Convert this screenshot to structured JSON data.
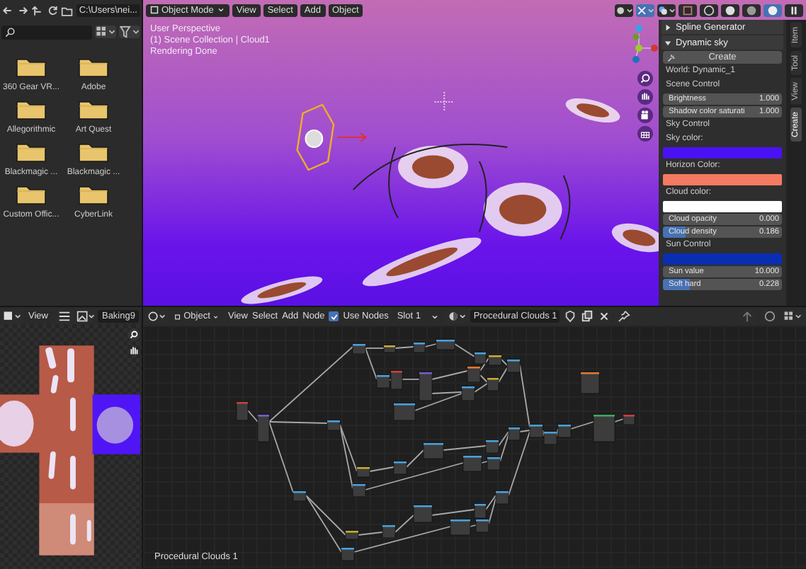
{
  "file_browser": {
    "path": "C:\\Users\\nei...",
    "folders": [
      {
        "name": "360 Gear VR..."
      },
      {
        "name": "Adobe"
      },
      {
        "name": "Allegorithmic"
      },
      {
        "name": "Art Quest"
      },
      {
        "name": "Blackmagic ..."
      },
      {
        "name": "Blackmagic ..."
      },
      {
        "name": "Custom Offic..."
      },
      {
        "name": "CyberLink"
      }
    ]
  },
  "image_editor": {
    "menu": "View",
    "image_name": "Baking9"
  },
  "viewport": {
    "mode": "Object Mode",
    "menus": [
      "View",
      "Select",
      "Add",
      "Object"
    ],
    "overlay_text": [
      "User Perspective",
      "(1) Scene Collection | Cloud1",
      "Rendering Done"
    ],
    "sidebar": {
      "panels": [
        {
          "title": "Spline Generator",
          "expanded": false
        },
        {
          "title": "Dynamic sky",
          "expanded": true,
          "create_button": "Create",
          "world": "World: Dynamic_1",
          "rows": [
            {
              "kind": "heading",
              "text": "Scene Control"
            },
            {
              "kind": "number",
              "label": "Brightness",
              "value": "1.000"
            },
            {
              "kind": "number",
              "label": "Shadow color saturati",
              "value": "1.000"
            },
            {
              "kind": "heading",
              "text": "Sky Control"
            },
            {
              "kind": "heading",
              "text": "Sky color:"
            },
            {
              "kind": "color",
              "color": "#4a12f2"
            },
            {
              "kind": "heading",
              "text": "Horizon Color:"
            },
            {
              "kind": "color",
              "color": "#f47a62"
            },
            {
              "kind": "heading",
              "text": "Cloud color:"
            },
            {
              "kind": "color",
              "color": "#ffffff"
            },
            {
              "kind": "number",
              "label": "Cloud opacity",
              "value": "0.000"
            },
            {
              "kind": "slider",
              "label": "Cloud density",
              "value": "0.186",
              "level": 0.186
            },
            {
              "kind": "heading",
              "text": "Sun Control"
            },
            {
              "kind": "color",
              "color": "#0a2eb2"
            },
            {
              "kind": "number",
              "label": "Sun value",
              "value": "10.000"
            },
            {
              "kind": "slider",
              "label": "Soft hard",
              "value": "0.228",
              "level": 0.228
            }
          ]
        }
      ]
    },
    "tabs": [
      {
        "label": "Item",
        "selected": false
      },
      {
        "label": "Tool",
        "selected": false
      },
      {
        "label": "View",
        "selected": false
      },
      {
        "label": "Create",
        "selected": true
      }
    ]
  },
  "node_editor": {
    "object_type": "Object",
    "menus": [
      "View",
      "Select",
      "Add",
      "Node"
    ],
    "use_nodes": {
      "label": "Use Nodes",
      "checked": true
    },
    "slot": "Slot 1",
    "material": "Procedural Clouds 1",
    "canvas_label": "Procedural Clouds 1"
  }
}
